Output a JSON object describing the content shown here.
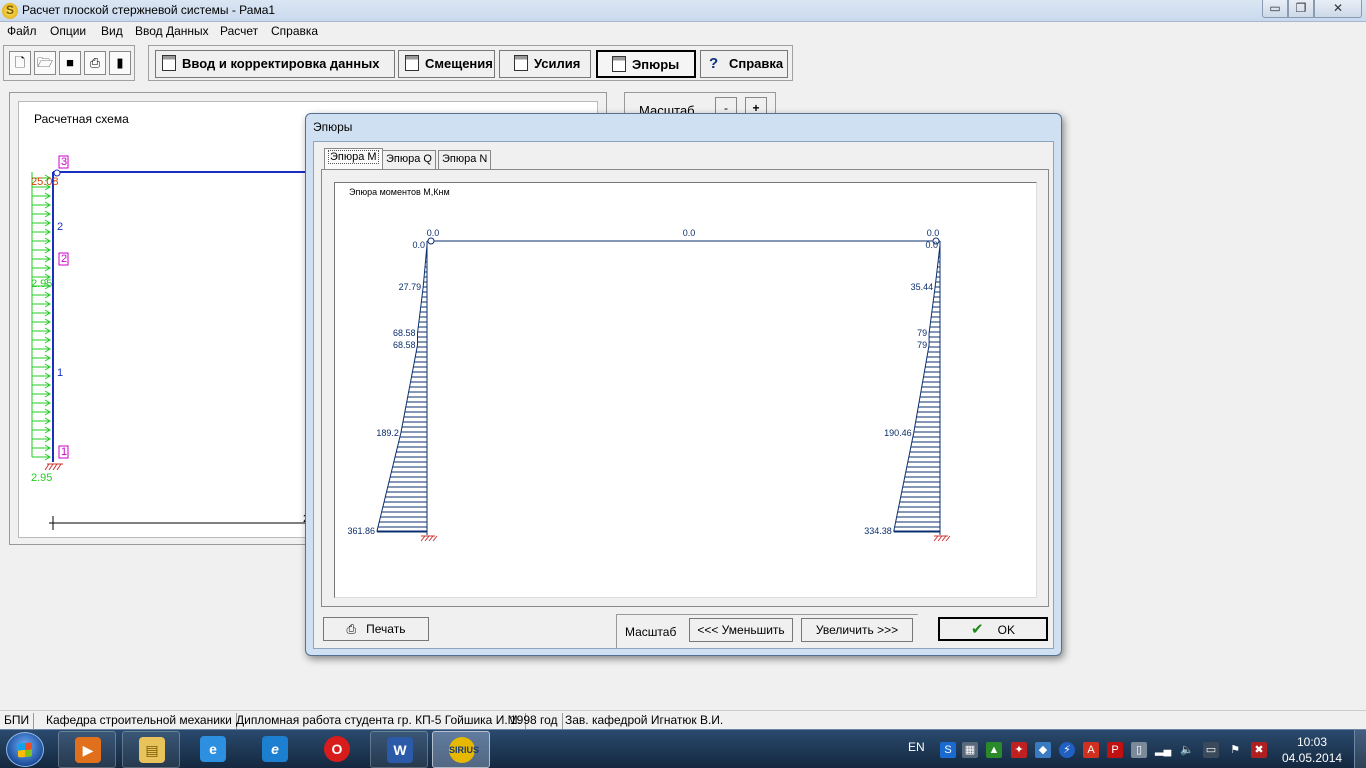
{
  "window": {
    "title": "Расчет плоской стержневой системы - Рама1",
    "minimize": "▭",
    "maximize": "❐",
    "close": "✕"
  },
  "menu": [
    "Файл",
    "Опции",
    "Вид",
    "Ввод Данных",
    "Расчет",
    "Справка"
  ],
  "toolbar": {
    "file_icons": [
      "new-file-icon",
      "open-folder-icon",
      "save-icon",
      "print-icon",
      "exit-door-icon"
    ],
    "buttons": [
      "Ввод и корректировка данных",
      "Смещения",
      "Усилия",
      "Эпюры",
      "Справка"
    ],
    "active_button": "Эпюры"
  },
  "scheme": {
    "title": "Расчетная схема",
    "node_labels": [
      "3",
      "2",
      "1"
    ],
    "element_labels": [
      "2",
      "1"
    ],
    "load_labels": [
      "25.08",
      "2.95",
      "2.95"
    ],
    "axis_label": "2"
  },
  "scale_box": {
    "label": "Масштаб",
    "minus": "-",
    "plus": "+"
  },
  "dialog": {
    "title": "Эпюры",
    "tabs": [
      "Эпюра M",
      "Эпюра Q",
      "Эпюра N"
    ],
    "active_tab": "Эпюра M",
    "diagram_title": "Эпюра моментов M,Кнм",
    "top_labels": [
      "0.0",
      "0.0",
      "0.0"
    ],
    "left_column": {
      "labels": [
        "0.0",
        "27.79",
        "68.58",
        "68.58",
        "189.2",
        "361.86"
      ],
      "values": [
        0.0,
        27.79,
        68.58,
        68.58,
        189.2,
        361.86
      ]
    },
    "right_column": {
      "labels": [
        "0.0",
        "35.44",
        "79",
        "79",
        "190.46",
        "334.38"
      ],
      "values": [
        0.0,
        35.44,
        79,
        79,
        190.46,
        334.38
      ]
    },
    "print_button": "Печать",
    "scale_label": "Масштаб",
    "decrease_button": "<<<   Уменьшить",
    "increase_button": "Увеличить   >>>",
    "ok_button": "OK"
  },
  "statusbar": [
    "БПИ",
    "Кафедра строительной механики",
    "Дипломная работа студента гр. КП-5 Гойшика И.М.",
    "1998 год",
    "Зав. кафедрой Игнатюк В.И."
  ],
  "taskbar": {
    "apps": [
      "media-player-icon",
      "explorer-folder-icon",
      "ie-icon",
      "ie-icon",
      "opera-icon",
      "word-icon",
      "sirius-icon"
    ],
    "language": "EN",
    "time": "10:03",
    "date": "04.05.2014"
  }
}
